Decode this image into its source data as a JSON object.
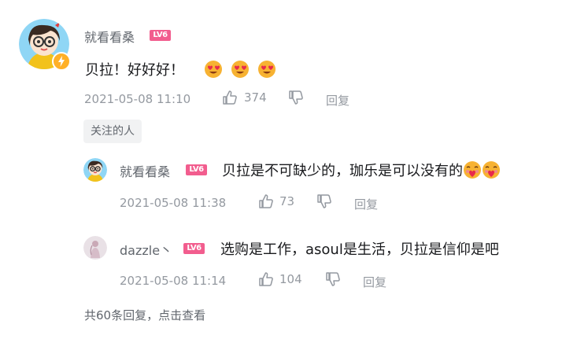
{
  "main_comment": {
    "username": "就看看桑",
    "level": "LV6",
    "content": "贝拉！好好好！",
    "emoji_names": [
      "heart-eyes-emoji",
      "heart-eyes-emoji",
      "heart-eyes-emoji"
    ],
    "time": "2021-05-08 11:10",
    "likes": "374",
    "reply_label": "回复",
    "tag": "关注的人"
  },
  "replies": [
    {
      "username": "就看看桑",
      "level": "LV6",
      "content": "贝拉是不可缺少的，珈乐是可以没有的",
      "emoji_names": [
        "blush-heart-emoji",
        "blush-heart-emoji"
      ],
      "time": "2021-05-08 11:38",
      "likes": "73",
      "reply_label": "回复"
    },
    {
      "username": "dazzle丶",
      "level": "LV6",
      "content": "选购是工作，asoul是生活，贝拉是信仰是吧",
      "time": "2021-05-08 11:14",
      "likes": "104",
      "reply_label": "回复"
    }
  ],
  "footer": {
    "more_replies": "共60条回复，点击查看"
  },
  "colors": {
    "level_badge": "#f25d8e",
    "meta_text": "#9499a0",
    "username_text": "#61666d",
    "vip_badge": "#ffb027"
  }
}
